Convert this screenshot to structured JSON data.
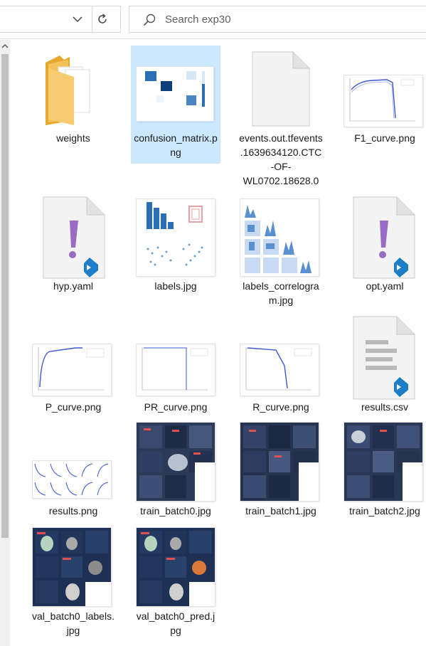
{
  "search": {
    "placeholder": "Search exp30"
  },
  "icons": {
    "search": "search-icon",
    "dropdown": "chevron-down-icon",
    "refresh": "refresh-icon",
    "scroll_up": "scroll-up-icon",
    "folder": "folder-icon",
    "file": "file-icon",
    "yaml": "yaml-file-icon",
    "csv": "csv-file-icon"
  },
  "colors": {
    "selection": "#cce8ff",
    "folder": "#f5c15b",
    "vscode": "#1e7ec8",
    "yaml": "#9a6bc2",
    "plot_line": "#3b57d6",
    "heatmap": "#1f6bb0"
  },
  "files": [
    {
      "name": "weights",
      "type": "folder"
    },
    {
      "name": "confusion_matrix.png",
      "type": "image",
      "selected": true
    },
    {
      "name": "events.out.tfevents.1639634120.CTC-OF-WL0702.18628.0",
      "type": "file"
    },
    {
      "name": "F1_curve.png",
      "type": "image"
    },
    {
      "name": "hyp.yaml",
      "type": "yaml"
    },
    {
      "name": "labels.jpg",
      "type": "image"
    },
    {
      "name": "labels_correlogram.jpg",
      "type": "image"
    },
    {
      "name": "opt.yaml",
      "type": "yaml"
    },
    {
      "name": "P_curve.png",
      "type": "image"
    },
    {
      "name": "PR_curve.png",
      "type": "image"
    },
    {
      "name": "R_curve.png",
      "type": "image"
    },
    {
      "name": "results.csv",
      "type": "csv"
    },
    {
      "name": "results.png",
      "type": "image"
    },
    {
      "name": "train_batch0.jpg",
      "type": "image"
    },
    {
      "name": "train_batch1.jpg",
      "type": "image"
    },
    {
      "name": "train_batch2.jpg",
      "type": "image"
    },
    {
      "name": "val_batch0_labels.jpg",
      "type": "image"
    },
    {
      "name": "val_batch0_pred.jpg",
      "type": "image"
    }
  ]
}
